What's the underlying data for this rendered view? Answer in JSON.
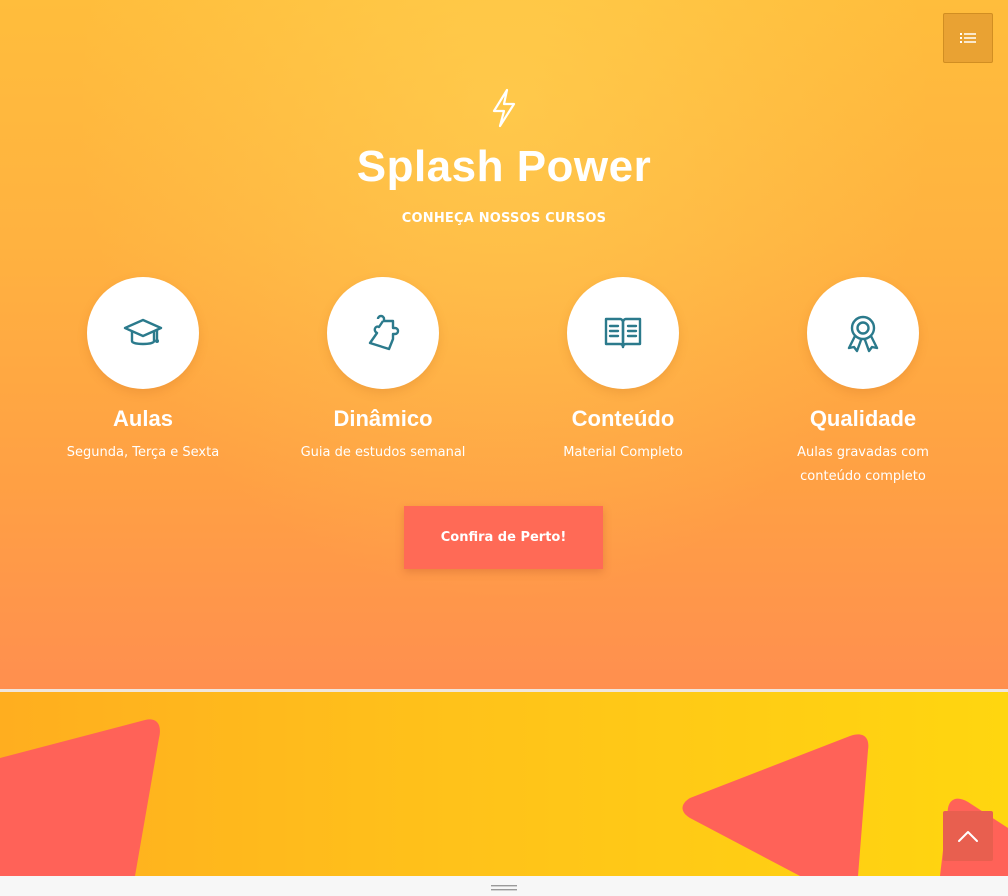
{
  "hero": {
    "title": "Splash Power",
    "subtitle": "CONHEÇA NOSSOS CURSOS",
    "icon": "lightning-bolt-icon",
    "cta_label": "Confira de Perto!",
    "features": [
      {
        "icon": "graduation-cap-icon",
        "title": "Aulas",
        "text": "Segunda, Terça e Sexta"
      },
      {
        "icon": "puzzle-piece-icon",
        "title": "Dinâmico",
        "text": "Guia de estudos semanal"
      },
      {
        "icon": "open-book-icon",
        "title": "Conteúdo",
        "text": "Material Completo"
      },
      {
        "icon": "award-ribbon-icon",
        "title": "Qualidade",
        "text": "Aulas gravadas com conteúdo completo"
      }
    ]
  },
  "controls": {
    "menu_icon": "list-icon",
    "scroll_top_icon": "chevron-up-icon",
    "handle_icon": "drag-handle-icon"
  },
  "colors": {
    "hero_gradient_top": "#ffbd3c",
    "hero_gradient_bottom": "#ff8f4f",
    "icon_accent": "#2b7a8c",
    "cta_background": "#ff6a56",
    "section2_gradient_left": "#ffae1f",
    "section2_gradient_right": "#ffd60f",
    "decor_shape": "#ff6258"
  }
}
